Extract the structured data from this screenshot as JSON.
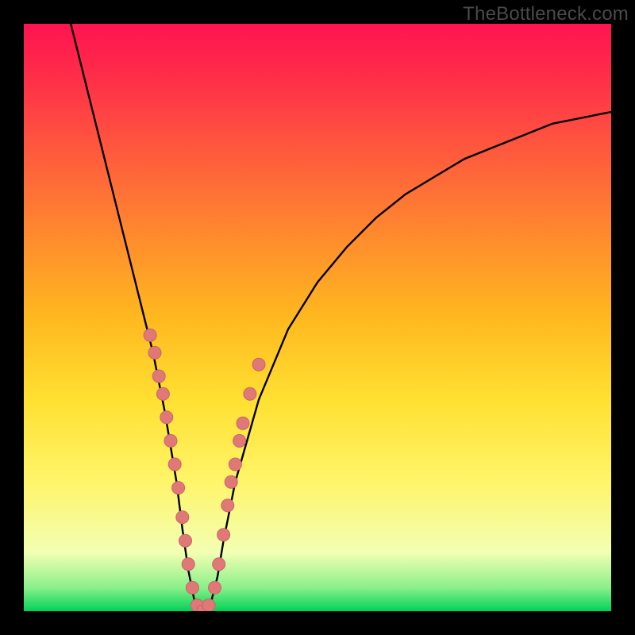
{
  "watermark": "TheBottleneck.com",
  "colors": {
    "background": "#000000",
    "curve": "#000000",
    "dot_fill": "#e07878",
    "dot_stroke": "#c86666"
  },
  "chart_data": {
    "type": "line",
    "title": "",
    "xlabel": "",
    "ylabel": "",
    "xlim": [
      0,
      100
    ],
    "ylim": [
      0,
      100
    ],
    "series": [
      {
        "name": "bottleneck-curve",
        "x": [
          8,
          10,
          12,
          14,
          16,
          18,
          20,
          22,
          24,
          26,
          27,
          28,
          29,
          30,
          31,
          32,
          33,
          34,
          36,
          40,
          45,
          50,
          55,
          60,
          65,
          70,
          75,
          80,
          85,
          90,
          95,
          100
        ],
        "y": [
          100,
          92,
          84,
          76,
          68,
          60,
          52,
          44,
          34,
          22,
          14,
          7,
          2,
          0,
          0,
          2,
          6,
          12,
          22,
          36,
          48,
          56,
          62,
          67,
          71,
          74,
          77,
          79,
          81,
          83,
          84,
          85
        ]
      }
    ],
    "dots": {
      "name": "highlight-points",
      "x": [
        21.5,
        22.3,
        23.0,
        23.7,
        24.3,
        25.0,
        25.7,
        26.3,
        27.0,
        27.5,
        28.0,
        28.7,
        29.5,
        30.5,
        31.5,
        32.5,
        33.2,
        34.0,
        34.7,
        35.3,
        36.0,
        36.7,
        37.3,
        38.5,
        40.0
      ],
      "y": [
        47,
        44,
        40,
        37,
        33,
        29,
        25,
        21,
        16,
        12,
        8,
        4,
        1,
        0,
        1,
        4,
        8,
        13,
        18,
        22,
        25,
        29,
        32,
        37,
        42
      ]
    }
  }
}
